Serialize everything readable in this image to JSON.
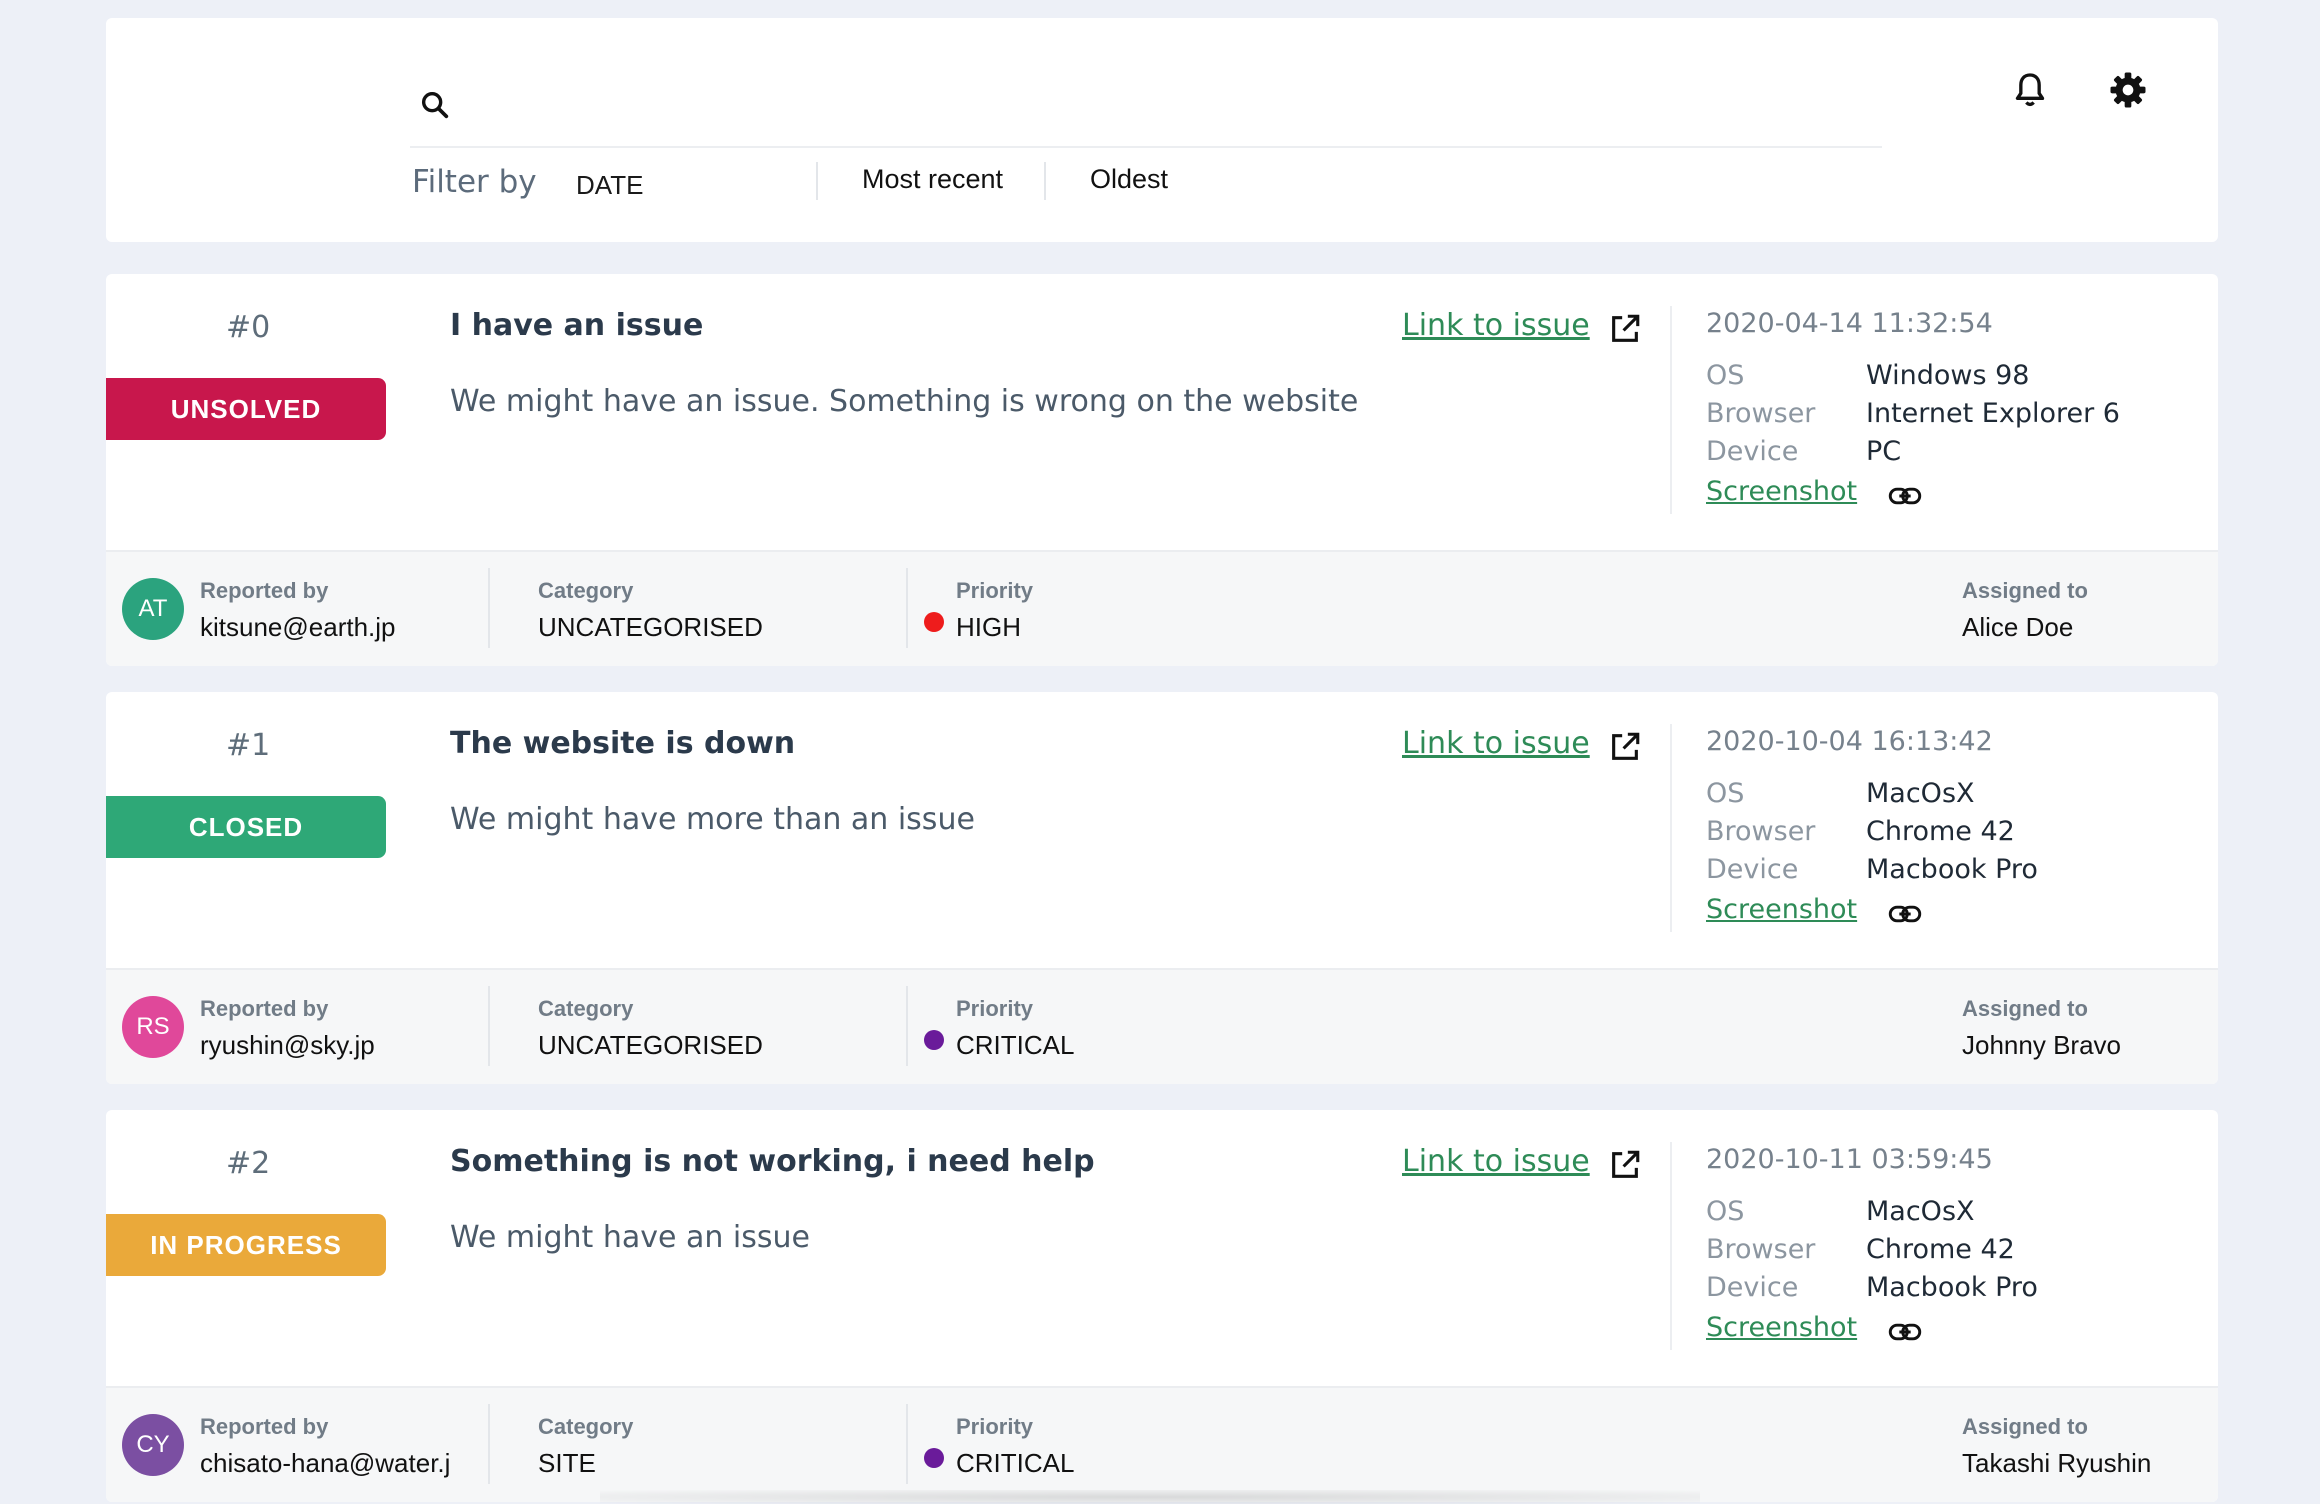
{
  "search": {
    "value": "",
    "placeholder": ""
  },
  "filter": {
    "label": "Filter by",
    "field": "DATE",
    "options": [
      "Most recent",
      "Oldest"
    ]
  },
  "footer_labels": {
    "reported_by": "Reported by",
    "category": "Category",
    "priority": "Priority",
    "assigned_to": "Assigned to"
  },
  "meta_labels": {
    "os": "OS",
    "browser": "Browser",
    "device": "Device"
  },
  "issues": [
    {
      "id": "#0",
      "status": "UNSOLVED",
      "status_color": "#c8174c",
      "title": "I have an issue",
      "description": "We might have an issue. Something is wrong on the website",
      "link_label": "Link to issue",
      "date": "2020-04-14 11:32:54",
      "os": "Windows 98",
      "browser": "Internet Explorer 6",
      "device": "PC",
      "screenshot_label": "Screenshot",
      "reporter_initials": "AT",
      "avatar_color": "#2ba37e",
      "reporter": "kitsune@earth.jp",
      "category": "UNCATEGORISED",
      "priority": "HIGH",
      "priority_color": "#ee1c1c",
      "assignee": "Alice Doe"
    },
    {
      "id": "#1",
      "status": "CLOSED",
      "status_color": "#2ea877",
      "title": "The website is down",
      "description": "We might have more than an issue",
      "link_label": "Link to issue",
      "date": "2020-10-04 16:13:42",
      "os": "MacOsX",
      "browser": "Chrome 42",
      "device": "Macbook Pro",
      "screenshot_label": "Screenshot",
      "reporter_initials": "RS",
      "avatar_color": "#e0489a",
      "reporter": "ryushin@sky.jp",
      "category": "UNCATEGORISED",
      "priority": "CRITICAL",
      "priority_color": "#6a1b9a",
      "assignee": "Johnny Bravo"
    },
    {
      "id": "#2",
      "status": "IN PROGRESS",
      "status_color": "#eaa93a",
      "title": "Something is not working, i need help",
      "description": "We might have an issue",
      "link_label": "Link to issue",
      "date": "2020-10-11 03:59:45",
      "os": "MacOsX",
      "browser": "Chrome 42",
      "device": "Macbook Pro",
      "screenshot_label": "Screenshot",
      "reporter_initials": "CY",
      "avatar_color": "#7b4fa2",
      "reporter": "chisato-hana@water.jp",
      "category": "SITE",
      "priority": "CRITICAL",
      "priority_color": "#6a1b9a",
      "assignee": "Takashi Ryushin"
    }
  ]
}
